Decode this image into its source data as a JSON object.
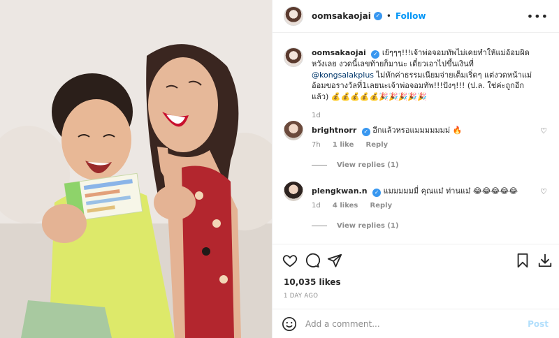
{
  "header": {
    "username": "oomsakaojai",
    "dot": "•",
    "follow_label": "Follow",
    "more_label": "•••"
  },
  "caption": {
    "username": "oomsakaojai",
    "text": "เย้ๆๆๆ!!!เจ้าพ่อจอมทัพไม่เคยทำให้แม่อ้อมผิดหวังเลย งวดนี้เลขท้ายก็มานะ เดี๋ยวเอาไปขึ้นเงินที่",
    "mention": "@kongsalakplus",
    "text2": "ไม่หักค่าธรรมเนียมจ่ายเต็มเริ่ดๆ แต่งวดหน้าแม่อ้อมขอรางวัลที่1เลยนะเจ้าพ่อจอมทัพ!!!ปังๆ!!! (ป.ล. ใช่ค่ะถูกอีกแล้ว) 💰💰💰💰💰🎉🎉🎉🎉🎉",
    "time": "1d"
  },
  "comments": [
    {
      "username": "brightnorr",
      "text": "อีกแล้วหรอแมมมมมมม่ 🔥",
      "time": "7h",
      "likes": "1 like",
      "reply_label": "Reply",
      "view_replies": "View replies (1)"
    },
    {
      "username": "plengkwan.n",
      "text": "แมมมมมมี่ คุณแม๋ ท่านแม๋ 😂😂😂😂😂",
      "time": "1d",
      "likes": "4 likes",
      "reply_label": "Reply",
      "view_replies": "View replies (1)"
    }
  ],
  "post": {
    "likes": "10,035 likes",
    "date": "1 DAY AGO",
    "comment_placeholder": "Add a comment...",
    "post_label": "Post"
  },
  "icons": {
    "like": "heart-icon",
    "comment": "comment-icon",
    "share": "share-icon",
    "save": "bookmark-icon",
    "download": "download-icon",
    "emoji": "emoji-icon"
  },
  "colors": {
    "accent": "#0095f6",
    "verified": "#3897f0",
    "muted": "#8e8e8e",
    "post_disabled": "#b2dffc"
  }
}
